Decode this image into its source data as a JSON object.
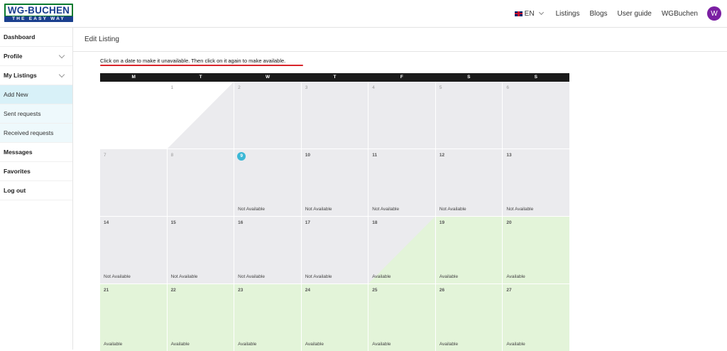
{
  "logo": {
    "line1": "WG-BUCHEN",
    "line2": "THE EASY WAY"
  },
  "nav": {
    "language": "EN",
    "links": [
      "Listings",
      "Blogs",
      "User guide",
      "WGBuchen"
    ],
    "avatar_letter": "W",
    "avatar_color": "#7b1fa2"
  },
  "sidebar": {
    "items": [
      {
        "label": "Dashboard"
      },
      {
        "label": "Profile"
      },
      {
        "label": "My Listings"
      },
      {
        "label": "Add New"
      },
      {
        "label": "Sent requests"
      },
      {
        "label": "Received requests"
      },
      {
        "label": "Messages"
      },
      {
        "label": "Favorites"
      },
      {
        "label": "Log out"
      }
    ]
  },
  "page": {
    "title": "Edit Listing",
    "instruction": "Click on a date to make it unavailable. Then click on it again to make available."
  },
  "calendar": {
    "weekdays": [
      "M",
      "T",
      "W",
      "T",
      "F",
      "S",
      "S"
    ],
    "days": [
      {
        "label": "",
        "status": "",
        "kind": "past"
      },
      {
        "label": "1",
        "status": "",
        "kind": "split-past-na"
      },
      {
        "label": "2",
        "status": "",
        "kind": "na-dim"
      },
      {
        "label": "3",
        "status": "",
        "kind": "na-dim"
      },
      {
        "label": "4",
        "status": "",
        "kind": "na-dim"
      },
      {
        "label": "5",
        "status": "",
        "kind": "na-dim"
      },
      {
        "label": "6",
        "status": "",
        "kind": "na-dim"
      },
      {
        "label": "7",
        "status": "",
        "kind": "na-dim"
      },
      {
        "label": "8",
        "status": "",
        "kind": "na-dim"
      },
      {
        "label": "9",
        "status": "Not Available",
        "kind": "today"
      },
      {
        "label": "10",
        "status": "Not Available",
        "kind": "na"
      },
      {
        "label": "11",
        "status": "Not Available",
        "kind": "na"
      },
      {
        "label": "12",
        "status": "Not Available",
        "kind": "na"
      },
      {
        "label": "13",
        "status": "Not Available",
        "kind": "na"
      },
      {
        "label": "14",
        "status": "Not Available",
        "kind": "na"
      },
      {
        "label": "15",
        "status": "Not Available",
        "kind": "na"
      },
      {
        "label": "16",
        "status": "Not Available",
        "kind": "na"
      },
      {
        "label": "17",
        "status": "Not Available",
        "kind": "na"
      },
      {
        "label": "18",
        "status": "Available",
        "kind": "split-na-av"
      },
      {
        "label": "19",
        "status": "Available",
        "kind": "av"
      },
      {
        "label": "20",
        "status": "Available",
        "kind": "av"
      },
      {
        "label": "21",
        "status": "Available",
        "kind": "av"
      },
      {
        "label": "22",
        "status": "Available",
        "kind": "av"
      },
      {
        "label": "23",
        "status": "Available",
        "kind": "av"
      },
      {
        "label": "24",
        "status": "Available",
        "kind": "av"
      },
      {
        "label": "25",
        "status": "Available",
        "kind": "av"
      },
      {
        "label": "26",
        "status": "Available",
        "kind": "av"
      },
      {
        "label": "27",
        "status": "Available",
        "kind": "av"
      }
    ]
  },
  "colors": {
    "unavailable": "#ebebee",
    "available": "#e3f4d9",
    "today": "#3cb8d6",
    "underline": "#d9252b"
  }
}
